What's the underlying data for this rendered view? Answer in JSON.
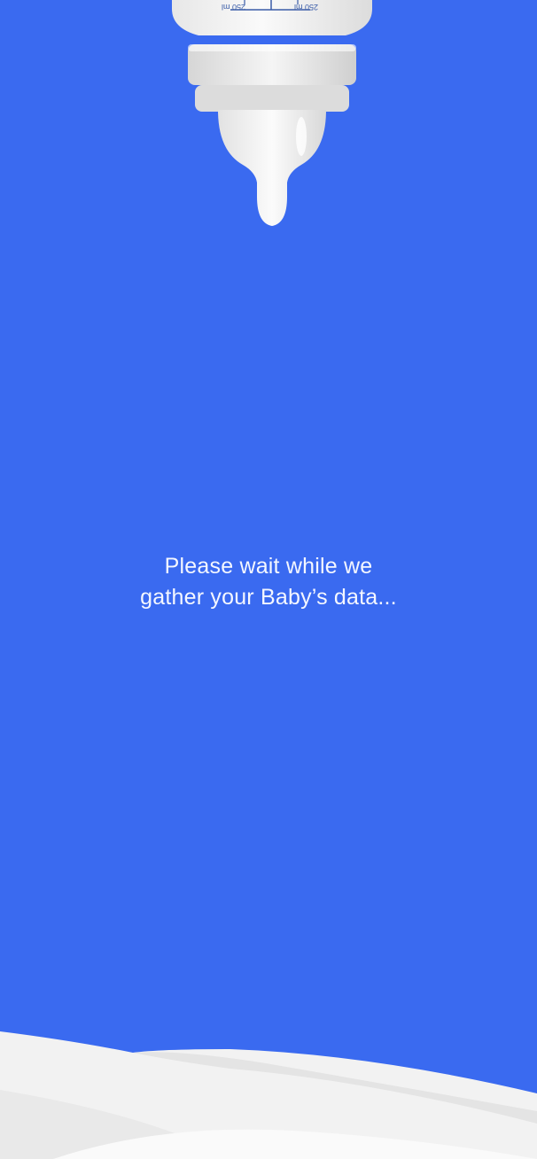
{
  "bottle": {
    "icon": "baby-bottle-icon",
    "scale_left": "250 ml",
    "scale_right": "250 ml"
  },
  "loading": {
    "line1": "Please wait while we",
    "line2": "gather your Baby’s data..."
  },
  "colors": {
    "background": "#3a6af0",
    "text": "#f4f7ff",
    "milk": "#f2f2f2",
    "scale_marks": "#3a5ca8"
  }
}
